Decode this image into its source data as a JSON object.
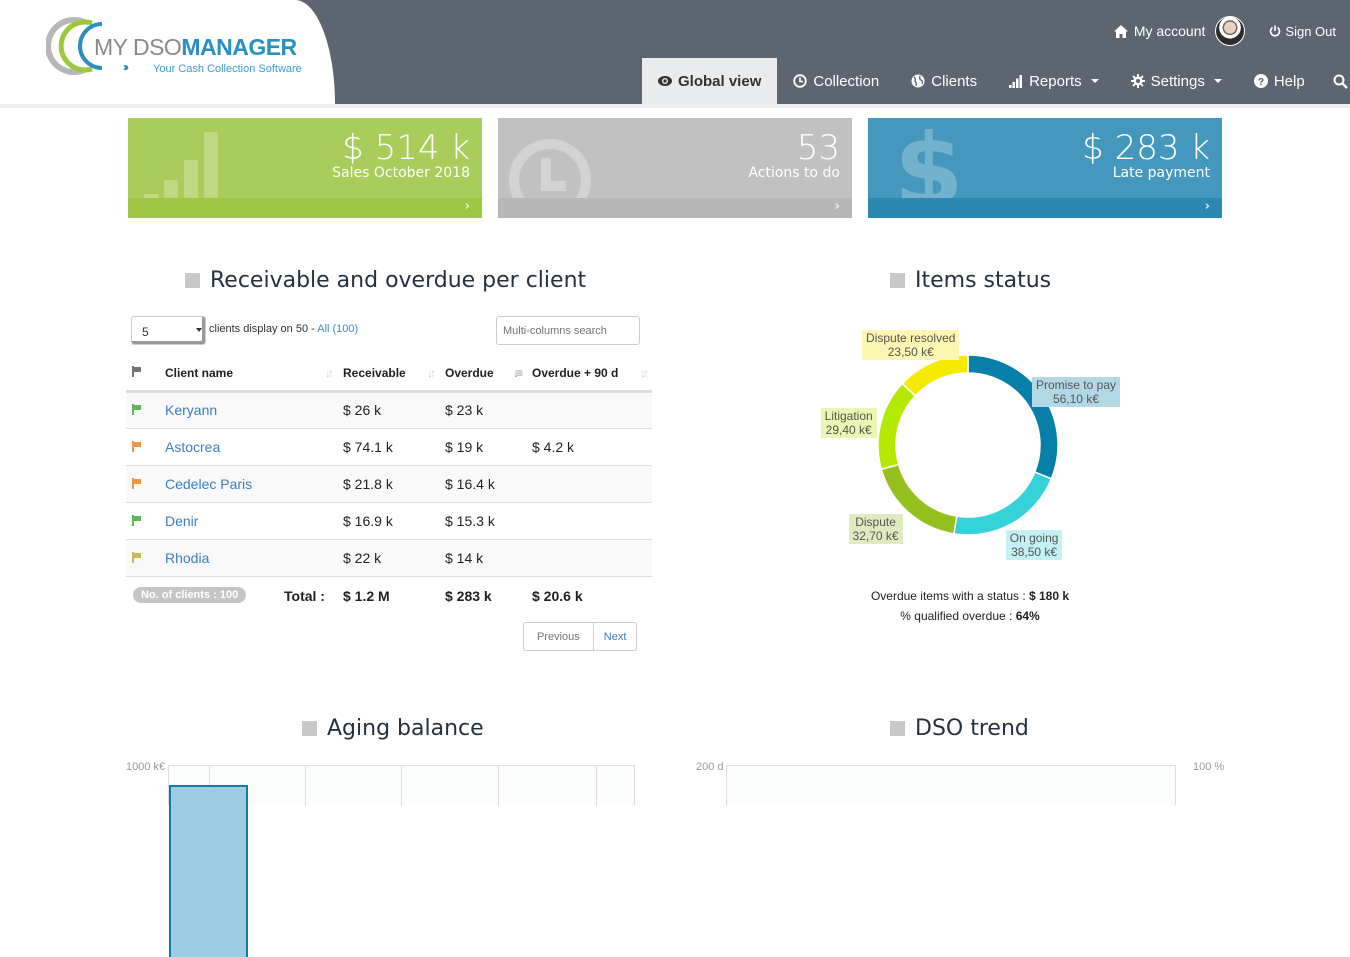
{
  "brand": {
    "name_light": "MY DSO",
    "name_bold": "MANAGER",
    "tagline": "Your Cash Collection Software"
  },
  "topbar": {
    "account_label": "My account",
    "signout_label": "Sign Out"
  },
  "nav": {
    "items": [
      {
        "label": "Global view",
        "icon": "eye-icon",
        "active": true
      },
      {
        "label": "Collection",
        "icon": "clock-icon"
      },
      {
        "label": "Clients",
        "icon": "globe-icon"
      },
      {
        "label": "Reports",
        "icon": "bar-chart-icon",
        "dropdown": true
      },
      {
        "label": "Settings",
        "icon": "gear-icon",
        "dropdown": true
      },
      {
        "label": "Help",
        "icon": "question-icon"
      }
    ],
    "search_icon": "search-icon"
  },
  "kpis": [
    {
      "value": "$ 514 k",
      "label": "Sales October 2018",
      "color": "#a8cd5b",
      "icon": "bar-chart-icon"
    },
    {
      "value": "53",
      "label": "Actions to do",
      "color": "#c1c1c1",
      "icon": "clock-icon"
    },
    {
      "value": "$ 283 k",
      "label": "Late payment",
      "color": "#4598bd",
      "icon": "dollar-icon"
    }
  ],
  "receivables": {
    "title": "Receivable and overdue per client",
    "page_size": "5",
    "display_text": "clients display on 50 - ",
    "all_link": "All (100)",
    "search_placeholder": "Multi-columns search",
    "columns": [
      "Client name",
      "Receivable",
      "Overdue",
      "Overdue + 90 d"
    ],
    "rows": [
      {
        "flag": "green",
        "client": "Keryann",
        "receivable": "$ 26 k",
        "overdue": "$ 23 k",
        "overdue90": ""
      },
      {
        "flag": "orange",
        "client": "Astocrea",
        "receivable": "$ 74.1 k",
        "overdue": "$ 19 k",
        "overdue90": "$ 4.2 k"
      },
      {
        "flag": "orange",
        "client": "Cedelec Paris",
        "receivable": "$ 21.8 k",
        "overdue": "$ 16.4 k",
        "overdue90": ""
      },
      {
        "flag": "green",
        "client": "Denir",
        "receivable": "$ 16.9 k",
        "overdue": "$ 15.3 k",
        "overdue90": ""
      },
      {
        "flag": "yellow",
        "client": "Rhodia",
        "receivable": "$ 22 k",
        "overdue": "$ 14 k",
        "overdue90": ""
      }
    ],
    "flag_colors": {
      "green": "#5cb85c",
      "orange": "#f0954a",
      "yellow": "#c9b95a",
      "header": "#777777"
    },
    "client_count_badge": "No. of clients : 100",
    "total_label": "Total :",
    "total_receivable": "$ 1.2 M",
    "total_overdue": "$ 283 k",
    "total_overdue90": "$ 20.6 k",
    "pager": {
      "previous": "Previous",
      "next": "Next"
    }
  },
  "items_status": {
    "title": "Items status",
    "overdue_with_status_label": "Overdue items with a status : ",
    "overdue_with_status_value": "$ 180 k",
    "qualified_label": "% qualified overdue : ",
    "qualified_value": "64%"
  },
  "aging": {
    "title": "Aging balance",
    "y_max_label": "1000 k€"
  },
  "dso": {
    "title": "DSO trend",
    "y_left_max_label": "200 d",
    "y_right_max_label": "100 %"
  },
  "chart_data": [
    {
      "type": "pie",
      "title": "Items status",
      "unit": "k€",
      "categories": [
        "Promise to pay",
        "On going",
        "Dispute",
        "Litigation",
        "Dispute resolved"
      ],
      "values": [
        56.1,
        38.5,
        32.7,
        29.4,
        23.5
      ],
      "value_labels": [
        "56,10 k€",
        "38,50 k€",
        "32,70 k€",
        "29,40 k€",
        "23,50 k€"
      ],
      "colors": [
        "#0680a8",
        "#35d2da",
        "#95c11f",
        "#b4ea00",
        "#f5ea00"
      ],
      "label_bg": [
        "#b2d8e6",
        "#c3f1f4",
        "#dfebbf",
        "#e9f7b2",
        "#fbf7b2"
      ],
      "donut": true
    },
    {
      "type": "bar",
      "title": "Aging balance",
      "ylabel": "k€",
      "ylim": [
        0,
        1000
      ],
      "y_tick_labels": [
        "1000 k€"
      ],
      "visible_bar_values": [
        900
      ]
    },
    {
      "type": "line",
      "title": "DSO trend",
      "y_left_label": "d",
      "y_right_label": "%",
      "ylim_left": [
        0,
        200
      ],
      "ylim_right": [
        0,
        100
      ],
      "y_tick_labels_left": [
        "200 d"
      ],
      "y_tick_labels_right": [
        "100 %"
      ]
    }
  ]
}
